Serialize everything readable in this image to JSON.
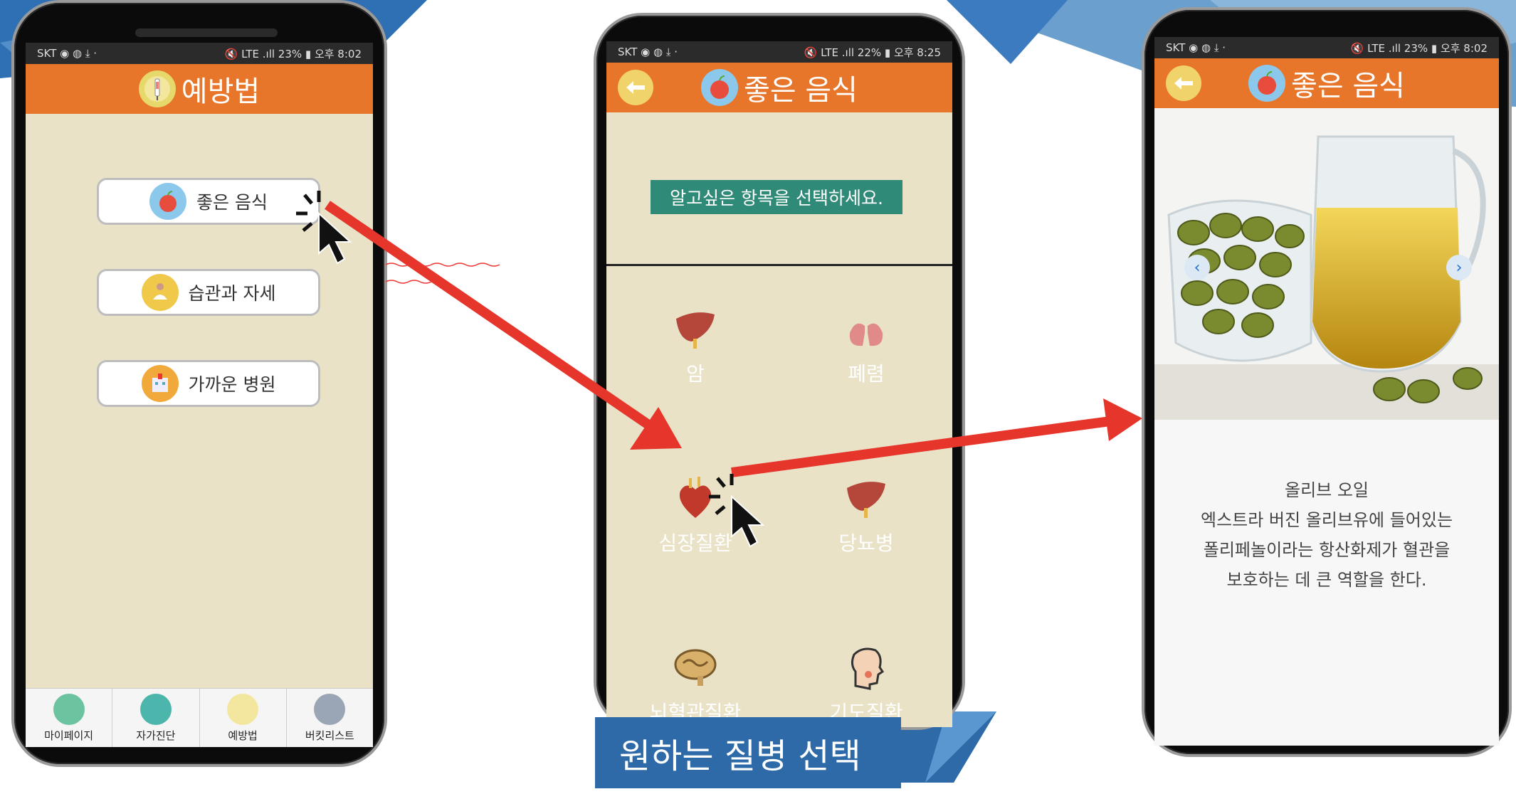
{
  "status": {
    "left": "SKT ◉ ◍ ⤓ ·",
    "right1": "🔇 LTE .ıll 23% ▮ 오후 8:02",
    "right2": "🔇 LTE .ıll 22% ▮ 오후 8:25",
    "right3": "🔇 LTE .ıll 23% ▮ 오후 8:02"
  },
  "screen1": {
    "title": "예방법",
    "menu": [
      {
        "label": "좋은 음식"
      },
      {
        "label": "습관과 자세"
      },
      {
        "label": "가까운 병원"
      }
    ],
    "nav": [
      {
        "label": "마이페이지"
      },
      {
        "label": "자가진단"
      },
      {
        "label": "예방법"
      },
      {
        "label": "버킷리스트"
      }
    ]
  },
  "screen2": {
    "title": "좋은 음식",
    "prompt": "알고싶은 항목을 선택하세요.",
    "diseases": [
      {
        "label": "암"
      },
      {
        "label": "폐렴"
      },
      {
        "label": "심장질환"
      },
      {
        "label": "당뇨병"
      },
      {
        "label": "뇌혈관질환"
      },
      {
        "label": "기도질환"
      }
    ]
  },
  "screen3": {
    "title": "좋은 음식",
    "desc_lines": [
      "올리브 오일",
      "엑스트라 버진 올리브유에 들어있는",
      "폴리페놀이라는 항산화제가 혈관을",
      "보호하는 데 큰 역할을 한다."
    ]
  },
  "banner": {
    "text": "원하는 질병 선택"
  },
  "colors": {
    "appbar": "#e8762a",
    "screen_bg": "#e9e2c7",
    "arrow": "#e6352b",
    "banner": "#2e6aa8"
  }
}
